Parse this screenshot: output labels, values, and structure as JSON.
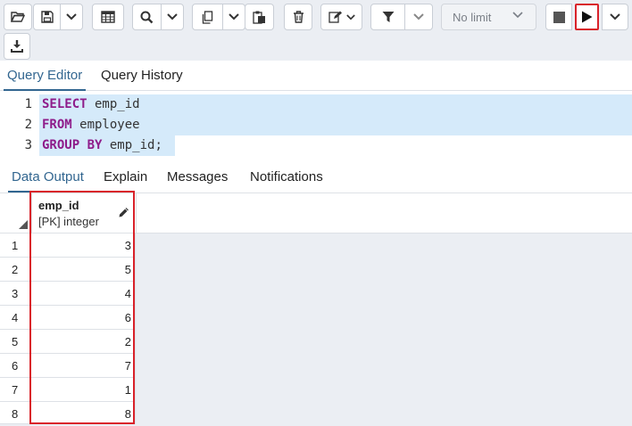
{
  "toolbar": {
    "limit_label": "No limit",
    "icons": [
      "folder-open-icon",
      "save-icon",
      "chevron-down-icon",
      "table-icon",
      "search-icon",
      "copy-icon",
      "paste-icon",
      "trash-icon",
      "edit-icon",
      "filter-icon",
      "stop-icon",
      "play-icon",
      "download-icon"
    ]
  },
  "editor_tabs": [
    "Query Editor",
    "Query History"
  ],
  "editor": {
    "lines": [
      {
        "num": "1",
        "kw": "SELECT",
        "rest": " emp_id"
      },
      {
        "num": "2",
        "kw": "FROM",
        "rest": " employee"
      },
      {
        "num": "3",
        "kw": "GROUP BY",
        "rest": " emp_id;"
      }
    ]
  },
  "output_tabs": [
    "Data Output",
    "Explain",
    "Messages",
    "Notifications"
  ],
  "grid": {
    "column": {
      "name": "emp_id",
      "type": "[PK] integer"
    },
    "rows": [
      {
        "num": "1",
        "value": "3"
      },
      {
        "num": "2",
        "value": "5"
      },
      {
        "num": "3",
        "value": "4"
      },
      {
        "num": "4",
        "value": "6"
      },
      {
        "num": "5",
        "value": "2"
      },
      {
        "num": "6",
        "value": "7"
      },
      {
        "num": "7",
        "value": "1"
      },
      {
        "num": "8",
        "value": "8"
      }
    ]
  },
  "colors": {
    "accent": "#326690",
    "keyword": "#8e1c8a",
    "highlight_box": "#d9222a",
    "selection": "#d5eafa"
  }
}
